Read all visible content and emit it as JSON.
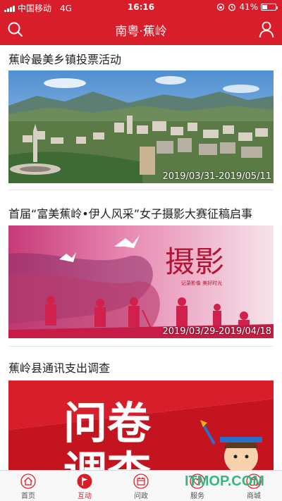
{
  "status_bar": {
    "carrier": "中国移动",
    "network": "4G",
    "time": "16:16",
    "battery_percent": "41%",
    "battery_level": 0.41
  },
  "nav": {
    "title": "南粤·蕉岭",
    "left_icon": "search-icon",
    "right_icon": "user-icon"
  },
  "articles": [
    {
      "title": "蕉岭最美乡镇投票活动",
      "date_range": "2019/03/31-2019/05/11"
    },
    {
      "title": "首届“富美蕉岭•伊人风采”女子摄影大赛征稿启事",
      "date_range": "2019/03/29-2019/04/18",
      "image_text": "摄影",
      "image_subtext": "记录影像 美好时光"
    },
    {
      "title": "蕉岭县通讯支出调查",
      "image_text_line1": "问卷",
      "image_text_line2": "调查"
    }
  ],
  "tabs": [
    {
      "label": "首页",
      "icon": "home-icon"
    },
    {
      "label": "互动",
      "icon": "flag-icon"
    },
    {
      "label": "问政",
      "icon": "calendar-icon"
    },
    {
      "label": "服务",
      "icon": "heart-icon"
    },
    {
      "label": "商城",
      "icon": "bag-icon"
    }
  ],
  "active_tab": "互动",
  "watermark": "ITMOP.COM",
  "colors": {
    "brand": "#d81e2a",
    "tab_bg": "#f8f8f8",
    "divider": "#e6e6e6"
  }
}
